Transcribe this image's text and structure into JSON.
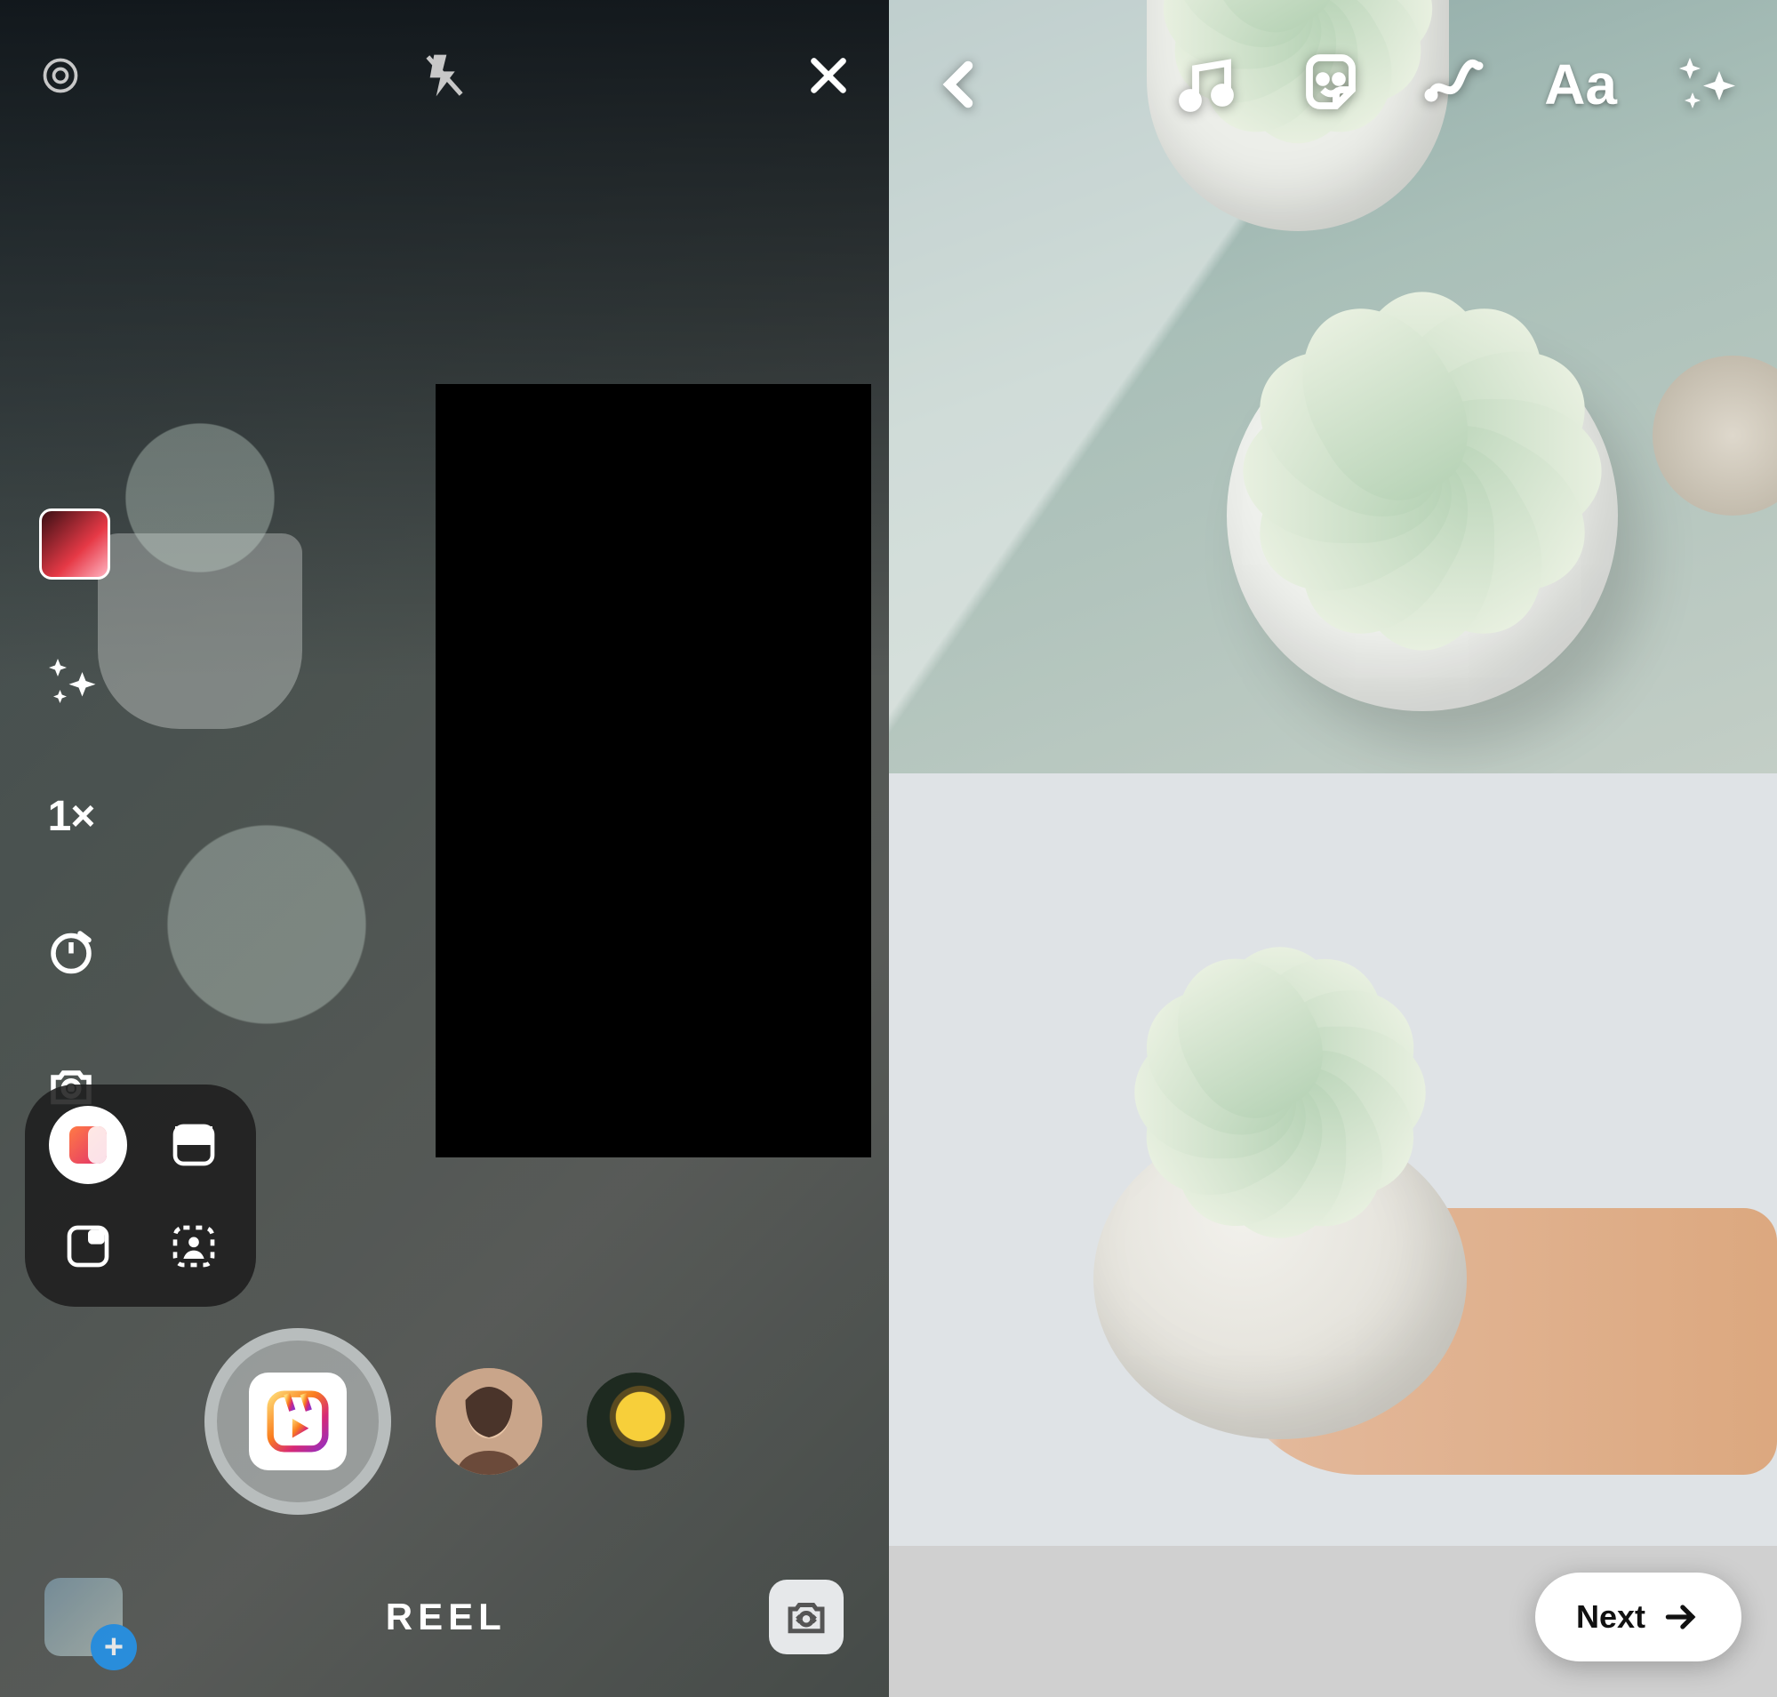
{
  "left": {
    "top": {
      "settings_icon": "settings",
      "flash_icon": "flash-off",
      "close_icon": "close"
    },
    "tools": {
      "audio_icon": "audio-thumbnail",
      "effects_icon": "sparkles",
      "speed_label": "1×",
      "timer_icon": "timer",
      "dual_icon": "dual-camera"
    },
    "layout": {
      "split_vertical": "layout-split-vertical",
      "split_horizontal": "layout-split-horizontal",
      "pip_corner": "layout-pip",
      "greenscreen": "layout-greenscreen"
    },
    "capture": {
      "capture_icon": "reels",
      "filter1": "avatar-person",
      "filter2": "avatar-sunflower"
    },
    "bottom": {
      "gallery_icon": "gallery",
      "add_badge": "+",
      "mode_label": "REEL",
      "flip_icon": "flip-camera"
    }
  },
  "right": {
    "toolbar": {
      "back_icon": "chevron-left",
      "music_icon": "music",
      "sticker_icon": "sticker",
      "draw_icon": "draw",
      "text_label": "Aa",
      "sparkle_icon": "sparkles"
    },
    "next_label": "Next"
  }
}
